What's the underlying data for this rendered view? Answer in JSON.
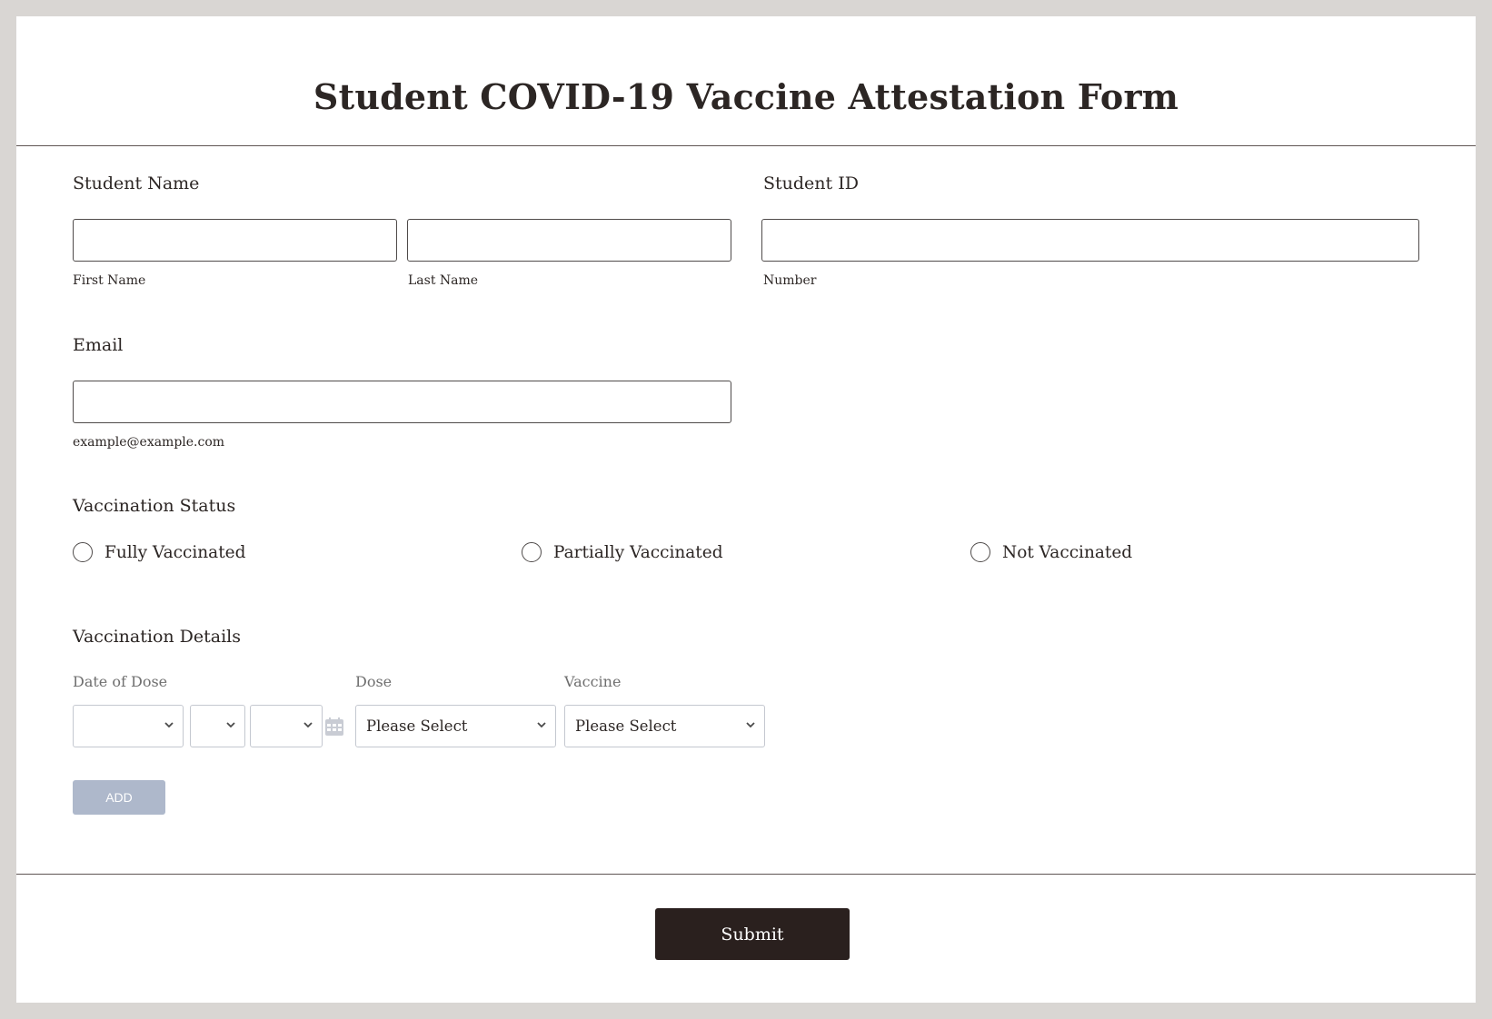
{
  "form": {
    "title": "Student COVID-19 Vaccine Attestation Form",
    "student_name": {
      "label": "Student Name",
      "first_sublabel": "First Name",
      "last_sublabel": "Last Name",
      "first_value": "",
      "last_value": ""
    },
    "student_id": {
      "label": "Student ID",
      "sublabel": "Number",
      "value": ""
    },
    "email": {
      "label": "Email",
      "sublabel": "example@example.com",
      "value": ""
    },
    "vaccination_status": {
      "label": "Vaccination Status",
      "options": [
        "Fully Vaccinated",
        "Partially Vaccinated",
        "Not Vaccinated"
      ]
    },
    "vaccination_details": {
      "label": "Vaccination Details",
      "columns": {
        "date": "Date of Dose",
        "dose": "Dose",
        "vaccine": "Vaccine"
      },
      "date_month": "",
      "date_day": "",
      "date_year": "",
      "dose_value": "Please Select",
      "vaccine_value": "Please Select",
      "add_label": "ADD"
    },
    "submit_label": "Submit"
  },
  "colors": {
    "page_bg": "#d9d6d3",
    "text": "#2c2624",
    "add_button": "#aeb8cb",
    "submit_button": "#2a201e"
  },
  "icons": {
    "calendar": "calendar-icon",
    "chevron": "chevron-down-icon"
  }
}
